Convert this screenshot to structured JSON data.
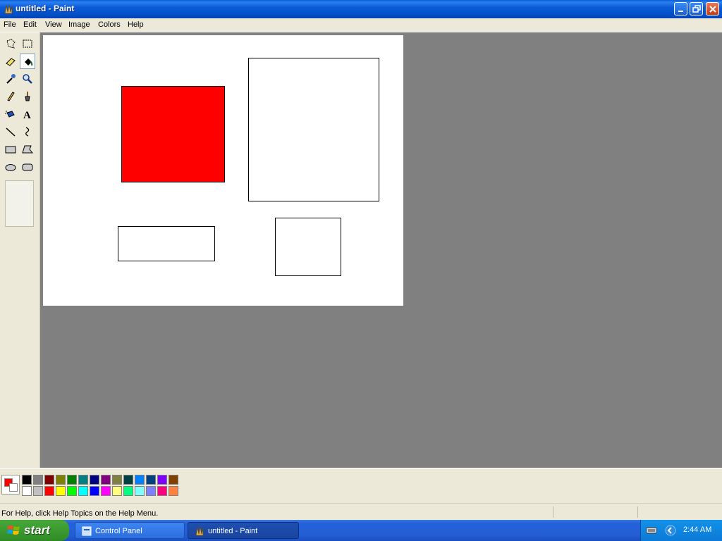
{
  "window": {
    "title": "untitled - Paint"
  },
  "menu": {
    "items": [
      "File",
      "Edit",
      "View",
      "Image",
      "Colors",
      "Help"
    ]
  },
  "toolbox": {
    "tools": [
      {
        "name": "free-form-select",
        "icon": "free-select-icon"
      },
      {
        "name": "select",
        "icon": "rect-select-icon"
      },
      {
        "name": "eraser",
        "icon": "eraser-icon"
      },
      {
        "name": "fill-with-color",
        "icon": "fill-bucket-icon",
        "active": true
      },
      {
        "name": "pick-color",
        "icon": "eyedropper-icon"
      },
      {
        "name": "magnifier",
        "icon": "magnifier-icon"
      },
      {
        "name": "pencil",
        "icon": "pencil-icon"
      },
      {
        "name": "brush",
        "icon": "brush-icon"
      },
      {
        "name": "airbrush",
        "icon": "airbrush-icon"
      },
      {
        "name": "text",
        "icon": "text-icon"
      },
      {
        "name": "line",
        "icon": "line-icon"
      },
      {
        "name": "curve",
        "icon": "curve-icon"
      },
      {
        "name": "rectangle",
        "icon": "rectangle-icon"
      },
      {
        "name": "polygon",
        "icon": "polygon-icon"
      },
      {
        "name": "ellipse",
        "icon": "ellipse-icon"
      },
      {
        "name": "rounded-rectangle",
        "icon": "rounded-rect-icon"
      }
    ]
  },
  "canvas": {
    "background": "#ffffff",
    "shapes": [
      {
        "type": "rectangle",
        "fill": "#ff0000"
      },
      {
        "type": "rectangle",
        "fill": "#ffffff"
      },
      {
        "type": "rectangle",
        "fill": "#ffffff"
      },
      {
        "type": "rectangle",
        "fill": "#ffffff"
      }
    ]
  },
  "colors": {
    "foreground": "#ff0000",
    "background": "#ffffff",
    "palette_row1": [
      "#000000",
      "#808080",
      "#800000",
      "#808000",
      "#008000",
      "#008080",
      "#000080",
      "#800080",
      "#808040",
      "#004040",
      "#0080ff",
      "#004080",
      "#8000ff",
      "#804000"
    ],
    "palette_row2": [
      "#ffffff",
      "#c0c0c0",
      "#ff0000",
      "#ffff00",
      "#00ff00",
      "#00ffff",
      "#0000ff",
      "#ff00ff",
      "#ffff80",
      "#00ff80",
      "#80ffff",
      "#8080ff",
      "#ff0080",
      "#ff8040"
    ]
  },
  "status": {
    "text": "For Help, click Help Topics on the Help Menu."
  },
  "taskbar": {
    "start_label": "start",
    "tasks": [
      "Control Panel",
      "untitled - Paint"
    ],
    "clock": "2:44 AM"
  }
}
